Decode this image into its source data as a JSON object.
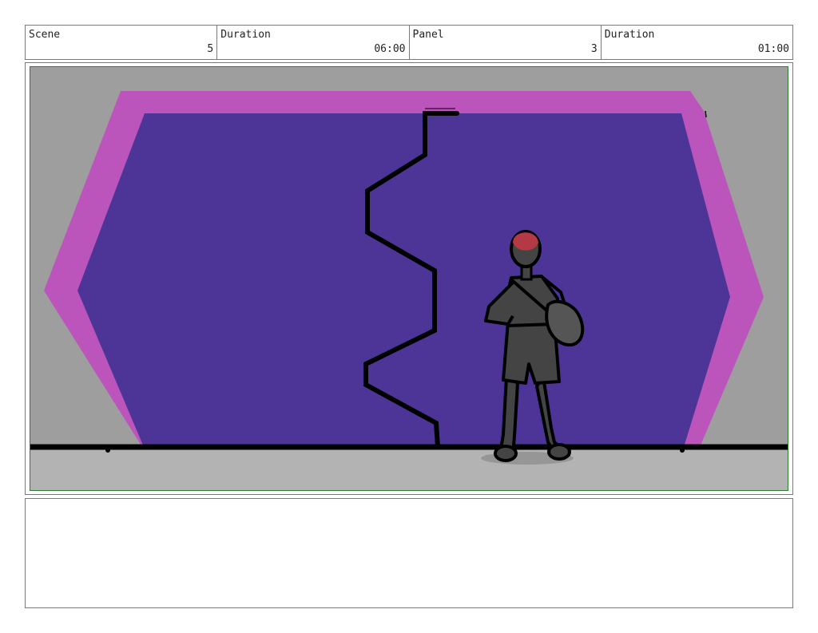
{
  "header": {
    "cells": [
      {
        "label": "Scene",
        "value": "5"
      },
      {
        "label": "Duration",
        "value": "06:00"
      },
      {
        "label": "Panel",
        "value": "3"
      },
      {
        "label": "Duration",
        "value": "01:00"
      }
    ]
  },
  "panel": {
    "colors": {
      "background": "#9e9e9e",
      "floor": "#b3b3b3",
      "window_frame": "#bb55bb",
      "window_fill": "#4d3597",
      "outline": "#000000",
      "figure": "#444444",
      "hair": "#b33a44",
      "border": "#2e7d32"
    }
  },
  "notes": {
    "text": ""
  }
}
